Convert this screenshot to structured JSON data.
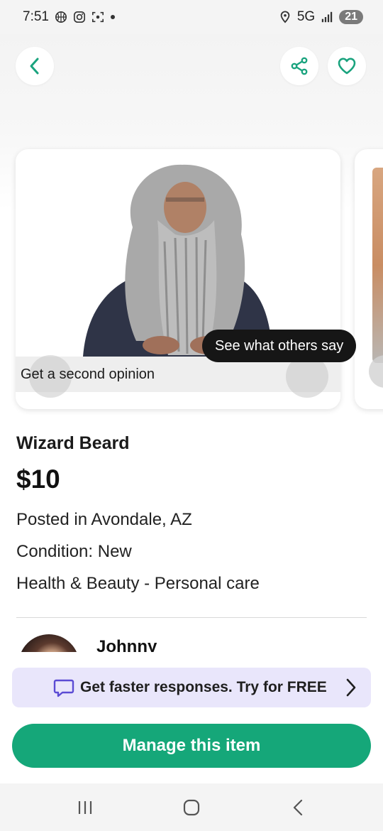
{
  "status_bar": {
    "time": "7:51",
    "network": "5G",
    "battery": "21",
    "icons": [
      "basketball-icon",
      "instagram-icon",
      "screenshot-icon",
      "dot-icon",
      "location-icon",
      "signal-icon"
    ]
  },
  "listing": {
    "second_opinion": "Get a second opinion",
    "see_others": "See what others say",
    "title": "Wizard Beard",
    "price": "$10",
    "posted": "Posted in Avondale, AZ",
    "condition": "Condition: New",
    "category": "Health & Beauty - Personal care"
  },
  "seller": {
    "name": "Johnny"
  },
  "promo": {
    "label": "Get faster responses. Try for FREE"
  },
  "actions": {
    "manage": "Manage this item"
  },
  "colors": {
    "accent": "#15a779",
    "promo_bg": "#e9e6fb",
    "icon_green": "#1aa37e",
    "chat_purple": "#5b4bd4"
  }
}
